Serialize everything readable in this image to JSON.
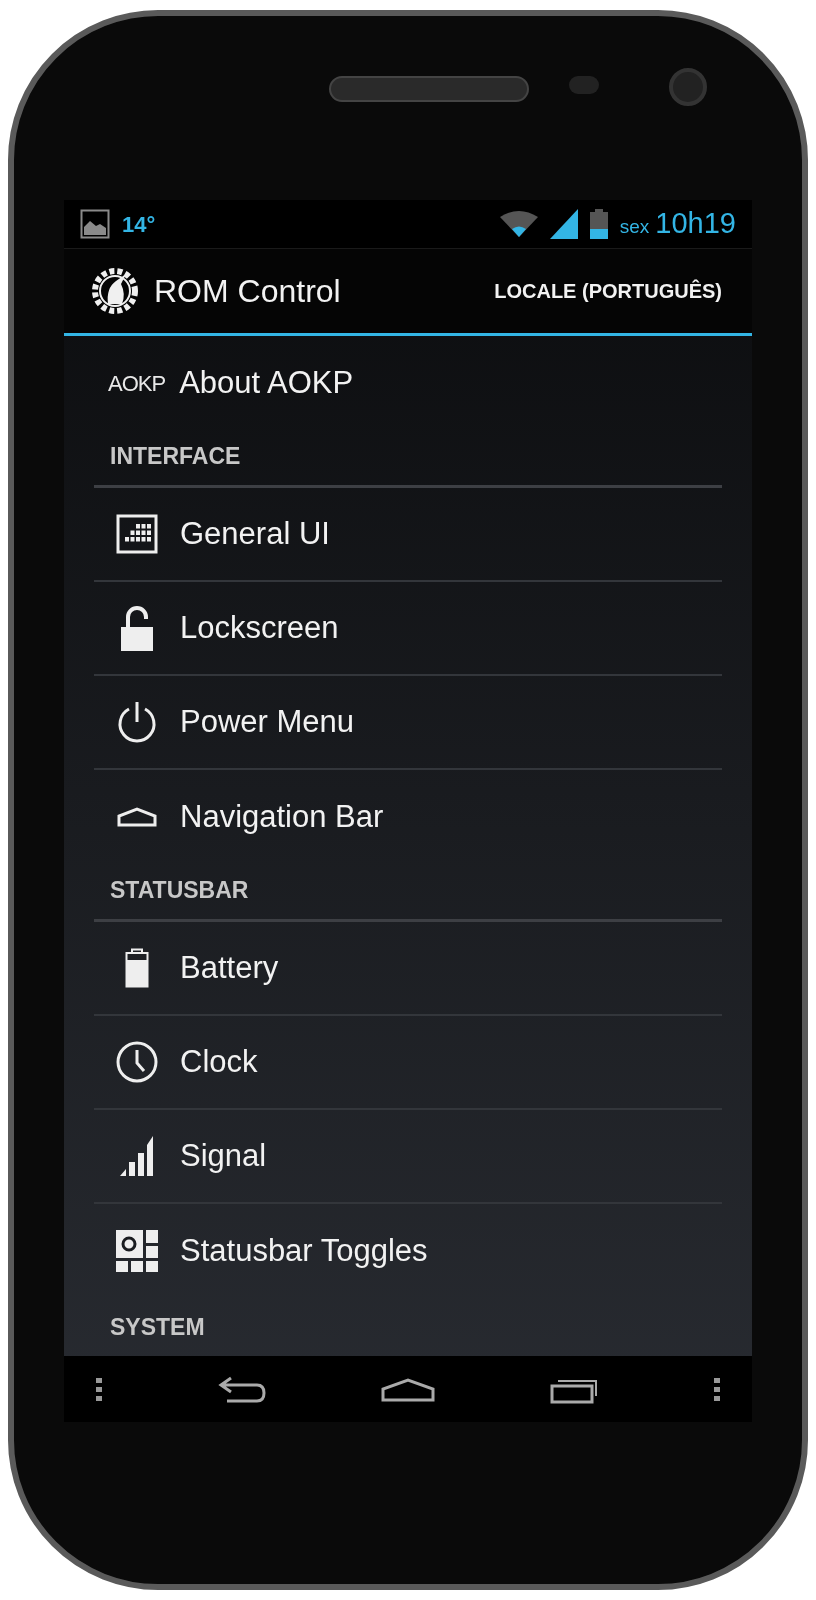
{
  "status_bar": {
    "temperature": "14°",
    "day": "sex",
    "time": "10h19"
  },
  "action_bar": {
    "title": "ROM Control",
    "action": "LOCALE (PORTUGUÊS)"
  },
  "about": {
    "logo": "AOKP",
    "label": "About AOKP"
  },
  "sections": [
    {
      "header": "INTERFACE",
      "items": [
        {
          "label": "General UI",
          "kind": "grid"
        },
        {
          "label": "Lockscreen",
          "kind": "lock"
        },
        {
          "label": "Power Menu",
          "kind": "power"
        },
        {
          "label": "Navigation Bar",
          "kind": "home"
        }
      ]
    },
    {
      "header": "STATUSBAR",
      "items": [
        {
          "label": "Battery",
          "kind": "battery"
        },
        {
          "label": "Clock",
          "kind": "clock"
        },
        {
          "label": "Signal",
          "kind": "signal"
        },
        {
          "label": "Statusbar Toggles",
          "kind": "toggles"
        }
      ]
    },
    {
      "header": "SYSTEM"
    }
  ]
}
